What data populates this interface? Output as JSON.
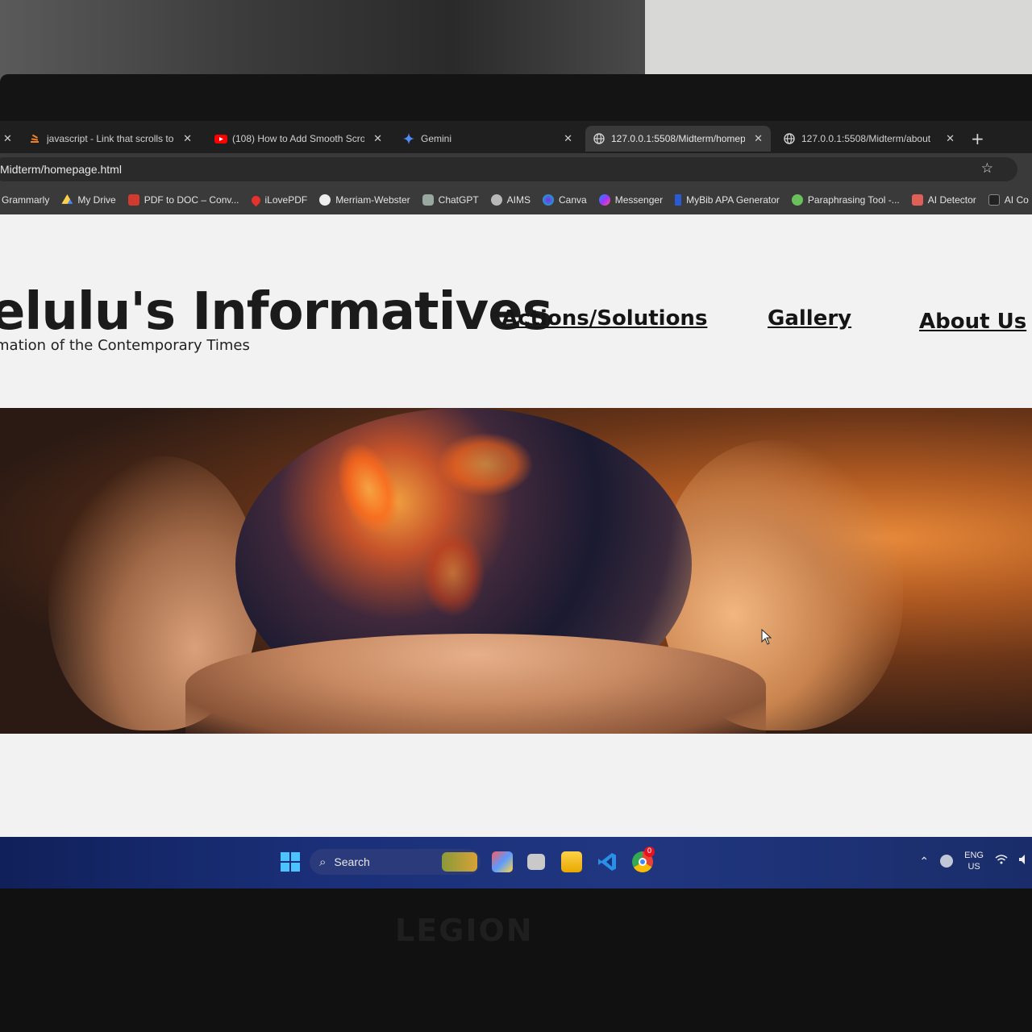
{
  "browser": {
    "tabs": [
      {
        "label": "javascript - Link that scrolls to p",
        "icon": "stackoverflow-icon",
        "close": "✕"
      },
      {
        "label": "(108) How to Add Smooth Scro",
        "icon": "youtube-icon",
        "close": "✕"
      },
      {
        "label": "Gemini",
        "icon": "gemini-icon",
        "close": "✕"
      },
      {
        "label": "127.0.0.1:5508/Midterm/homep",
        "icon": "globe-icon",
        "close": "✕",
        "active": true
      },
      {
        "label": "127.0.0.1:5508/Midterm/about",
        "icon": "globe-icon",
        "close": "✕"
      }
    ],
    "first_tab_close": "✕",
    "new_tab": "+",
    "url": "Midterm/homepage.html",
    "star": "☆",
    "bookmarks": [
      {
        "label": "Grammarly",
        "icon": "grammarly-icon"
      },
      {
        "label": "My Drive",
        "icon": "drive-icon"
      },
      {
        "label": "PDF to DOC – Conv...",
        "icon": "pdf-icon"
      },
      {
        "label": "iLovePDF",
        "icon": "ilovepdf-icon"
      },
      {
        "label": "Merriam-Webster",
        "icon": "mw-icon"
      },
      {
        "label": "ChatGPT",
        "icon": "chatgpt-icon"
      },
      {
        "label": "AIMS",
        "icon": "globe-icon"
      },
      {
        "label": "Canva",
        "icon": "canva-icon"
      },
      {
        "label": "Messenger",
        "icon": "messenger-icon"
      },
      {
        "label": "MyBib APA Generator",
        "icon": "mybib-icon"
      },
      {
        "label": "Paraphrasing Tool -...",
        "icon": "paraphrase-icon"
      },
      {
        "label": "AI Detector",
        "icon": "ai-detector-icon"
      },
      {
        "label": "AI Co",
        "icon": "ai-icon"
      }
    ]
  },
  "site": {
    "title": "elulu's Informatives",
    "tagline": "mation of the Contemporary Times",
    "nav": [
      "Actions/Solutions",
      "Gallery",
      "About Us"
    ]
  },
  "taskbar": {
    "search_label": "Search",
    "lang_top": "ENG",
    "lang_bottom": "US",
    "chrome_badge": "0"
  },
  "device": {
    "brand": "LEGION"
  },
  "colors": {
    "tab_strip": "#1f1f1f",
    "toolbar": "#3a3a3a",
    "page_bg": "#f2f2f2",
    "taskbar": "#1a2f78",
    "windows_accent": "#4cc2ff"
  }
}
